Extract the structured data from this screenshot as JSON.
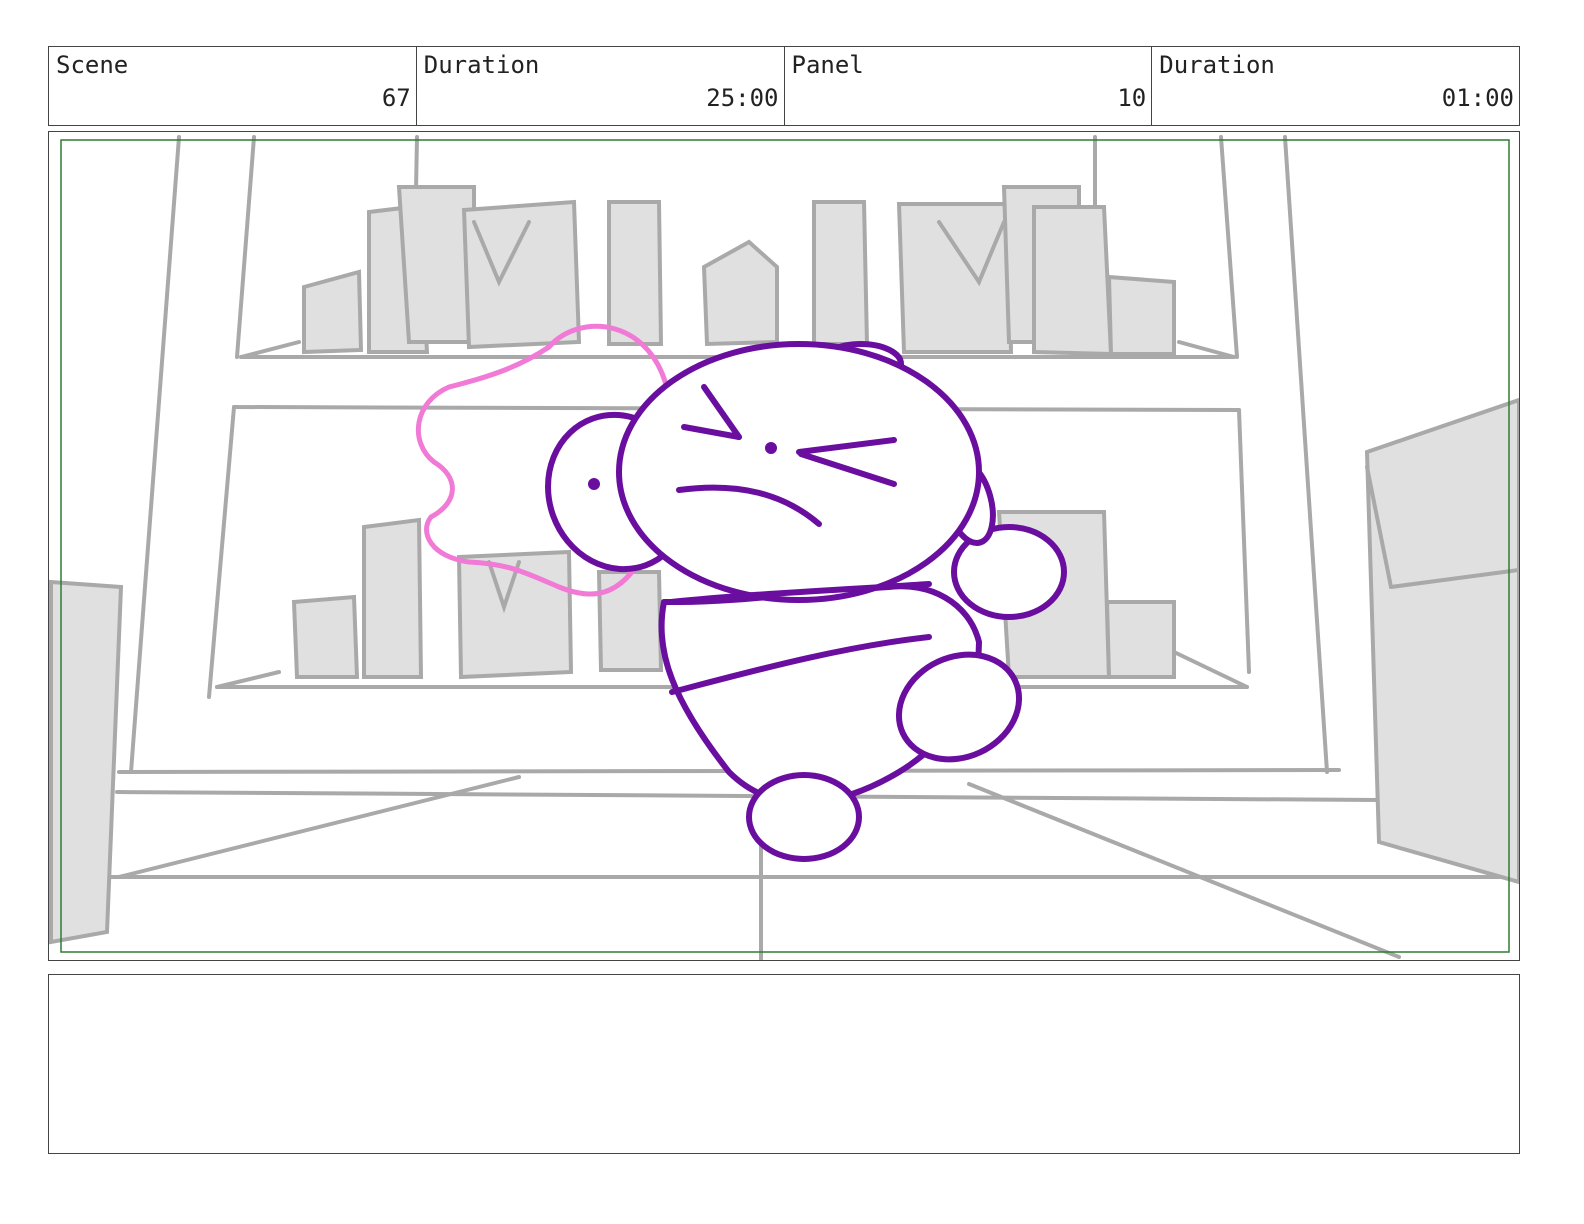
{
  "header": {
    "scene_label": "Scene",
    "scene_value": "67",
    "scene_duration_label": "Duration",
    "scene_duration_value": "25:00",
    "panel_label": "Panel",
    "panel_value": "10",
    "panel_duration_label": "Duration",
    "panel_duration_value": "01:00"
  },
  "drawing": {
    "background_color": "#a9a9a9",
    "fill_color": "#e0e0e0",
    "character_color": "#6a0ea0",
    "accessory_color": "#f07ad6",
    "safe_frame_color": "#2e7d32"
  },
  "notes": {
    "text": ""
  }
}
